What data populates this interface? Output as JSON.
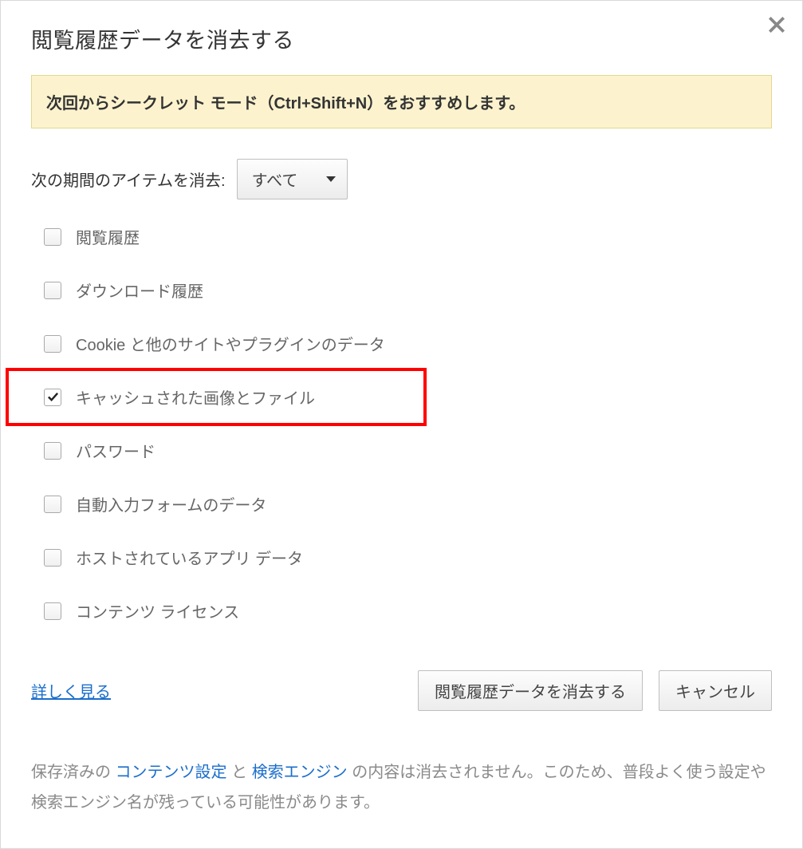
{
  "dialog": {
    "title": "閲覧履歴データを消去する",
    "banner": "次回からシークレット モード（Ctrl+Shift+N）をおすすめします。",
    "timeLabel": "次の期間のアイテムを消去:",
    "timeValue": "すべて",
    "options": [
      {
        "label": "閲覧履歴",
        "checked": false
      },
      {
        "label": "ダウンロード履歴",
        "checked": false
      },
      {
        "label": "Cookie と他のサイトやプラグインのデータ",
        "checked": false
      },
      {
        "label": "キャッシュされた画像とファイル",
        "checked": true,
        "highlighted": true
      },
      {
        "label": "パスワード",
        "checked": false
      },
      {
        "label": "自動入力フォームのデータ",
        "checked": false
      },
      {
        "label": "ホストされているアプリ データ",
        "checked": false
      },
      {
        "label": "コンテンツ ライセンス",
        "checked": false
      }
    ],
    "learnMore": "詳しく見る",
    "clearButton": "閲覧履歴データを消去する",
    "cancelButton": "キャンセル",
    "footer": {
      "pre": "保存済みの ",
      "link1": "コンテンツ設定",
      "mid": " と ",
      "link2": "検索エンジン",
      "post": " の内容は消去されません。このため、普段よく使う設定や検索エンジン名が残っている可能性があります。"
    }
  }
}
